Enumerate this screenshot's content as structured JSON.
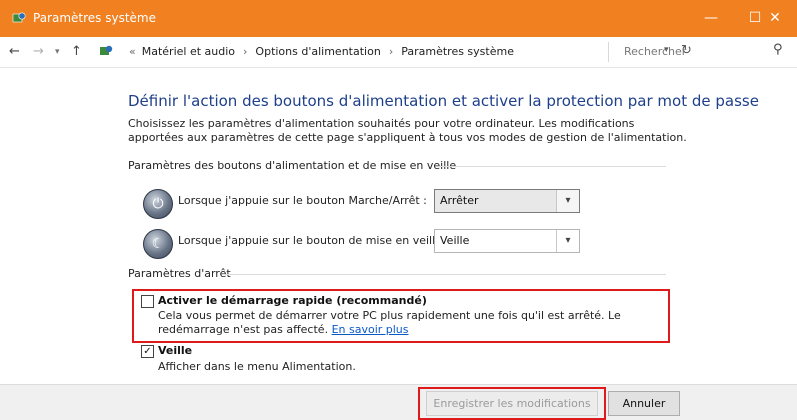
{
  "window": {
    "title": "Paramètres système",
    "controls": {
      "minimize": "—",
      "maximize": "☐",
      "close": "✕"
    }
  },
  "addressbar": {
    "breadcrumbs": [
      "Matériel et audio",
      "Options d'alimentation",
      "Paramètres système"
    ],
    "search_placeholder": "Rechercher"
  },
  "main": {
    "heading": "Définir l'action des boutons d'alimentation et activer la protection par mot de passe",
    "description": "Choisissez les paramètres d'alimentation souhaités pour votre ordinateur. Les modifications apportées aux paramètres de cette page s'appliquent à tous vos modes de gestion de l'alimentation.",
    "power_buttons_section": {
      "title": "Paramètres des boutons d'alimentation et de mise en veille",
      "rows": [
        {
          "label": "Lorsque j'appuie sur le bouton Marche/Arrêt :",
          "value": "Arrêter"
        },
        {
          "label": "Lorsque j'appuie sur le bouton de mise en veille :",
          "value": "Veille"
        }
      ]
    },
    "shutdown_section": {
      "title": "Paramètres d'arrêt",
      "fast_startup": {
        "label": "Activer le démarrage rapide (recommandé)",
        "checked": false,
        "description": "Cela vous permet de démarrer votre PC plus rapidement une fois qu'il est arrêté. Le redémarrage n'est pas affecté.",
        "link": "En savoir plus"
      },
      "sleep": {
        "label": "Veille",
        "checked": true,
        "description": "Afficher dans le menu Alimentation."
      }
    }
  },
  "footer": {
    "save_label": "Enregistrer les modifications",
    "cancel_label": "Annuler"
  },
  "colors": {
    "titlebar": "#f08020",
    "heading": "#1e3f8a",
    "highlight": "#e01a1a",
    "link": "#0a59c8"
  }
}
